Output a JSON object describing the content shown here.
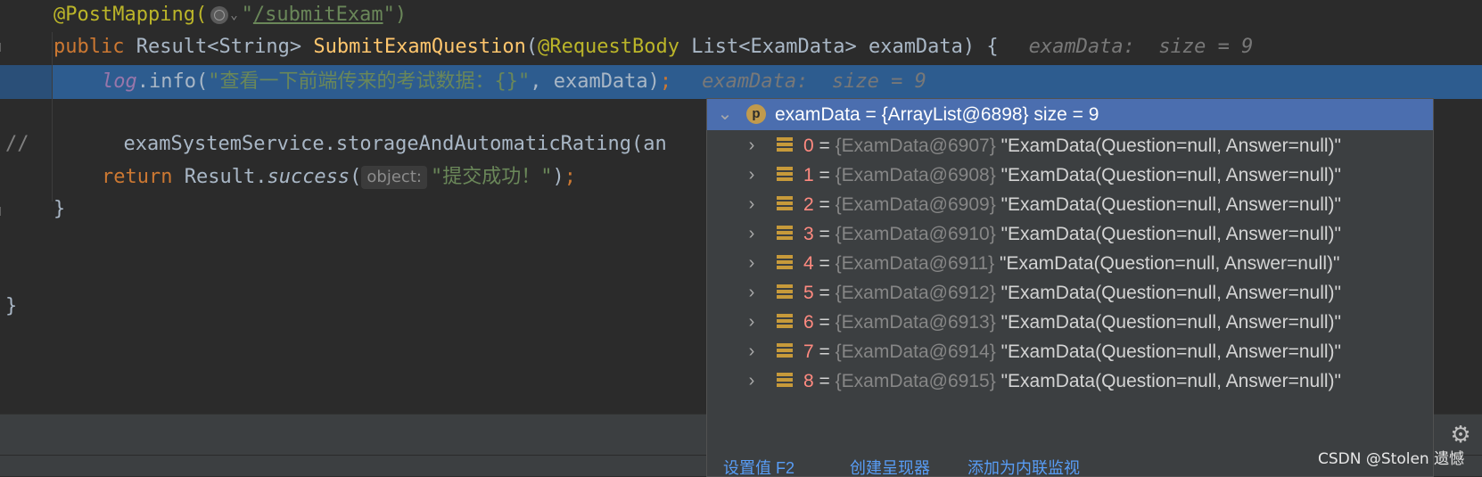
{
  "code": {
    "line1": {
      "annotation": "@PostMapping(",
      "quote_open": "\"",
      "path": "/submitExam",
      "quote_close": "\")"
    },
    "line2": {
      "kw_public": "public",
      "type_sig": " Result<String> ",
      "method": "SubmitExamQuestion",
      "paren": "(",
      "annotation": "@RequestBody",
      "params": " List<ExamData> examData) {",
      "hint": "examData:  size = 9"
    },
    "line3": {
      "log": "log",
      "call": ".info(",
      "str": "\"查看一下前端传来的考试数据：{}\"",
      "rest": ", examData)",
      "semi": ";",
      "hint": "examData:  size = 9"
    },
    "line5": {
      "comment": "//",
      "code": "examSystemService.storageAndAutomaticRating(an"
    },
    "line6": {
      "kw_return": "return",
      "call_obj": " Result.",
      "call_method": "success",
      "paren": "(",
      "param_hint": "object:",
      "str": "\"提交成功！\"",
      "close": ")",
      "semi": ";"
    },
    "line7": {
      "brace": "}"
    },
    "line9": {
      "brace": "}"
    }
  },
  "debugger": {
    "root": {
      "name": "examData",
      "eq": " = ",
      "value": "{ArrayList@6898}",
      "size": "  size = 9",
      "badge": "p"
    },
    "items": [
      {
        "index": "0",
        "ref": "{ExamData@6907}",
        "value": "\"ExamData(Question=null, Answer=null)\""
      },
      {
        "index": "1",
        "ref": "{ExamData@6908}",
        "value": "\"ExamData(Question=null, Answer=null)\""
      },
      {
        "index": "2",
        "ref": "{ExamData@6909}",
        "value": "\"ExamData(Question=null, Answer=null)\""
      },
      {
        "index": "3",
        "ref": "{ExamData@6910}",
        "value": "\"ExamData(Question=null, Answer=null)\""
      },
      {
        "index": "4",
        "ref": "{ExamData@6911}",
        "value": "\"ExamData(Question=null, Answer=null)\""
      },
      {
        "index": "5",
        "ref": "{ExamData@6912}",
        "value": "\"ExamData(Question=null, Answer=null)\""
      },
      {
        "index": "6",
        "ref": "{ExamData@6913}",
        "value": "\"ExamData(Question=null, Answer=null)\""
      },
      {
        "index": "7",
        "ref": "{ExamData@6914}",
        "value": "\"ExamData(Question=null, Answer=null)\""
      },
      {
        "index": "8",
        "ref": "{ExamData@6915}",
        "value": "\"ExamData(Question=null, Answer=null)\""
      }
    ],
    "footer": {
      "set_value": "设置值 F2",
      "create_renderer": "创建呈现器",
      "add_watch": "添加为内联监视"
    }
  },
  "watermark": "CSDN @Stolen 遗憾",
  "colors": {
    "highlight": "#2d5c8f",
    "selected_row": "#4b6eaf",
    "popup_bg": "#3c3f41"
  }
}
